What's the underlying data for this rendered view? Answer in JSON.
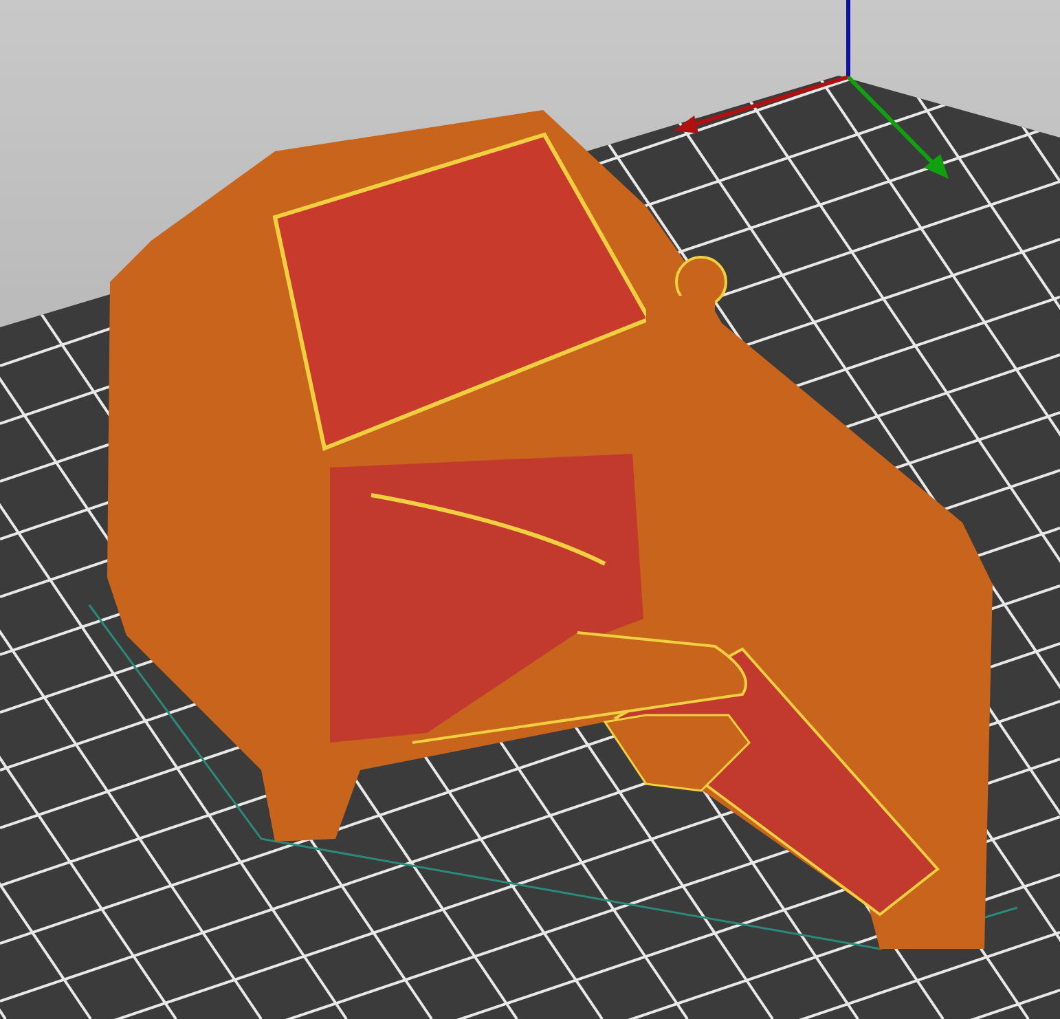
{
  "viewport": {
    "kind": "gcode-preview",
    "axes": {
      "shown": true
    }
  }
}
